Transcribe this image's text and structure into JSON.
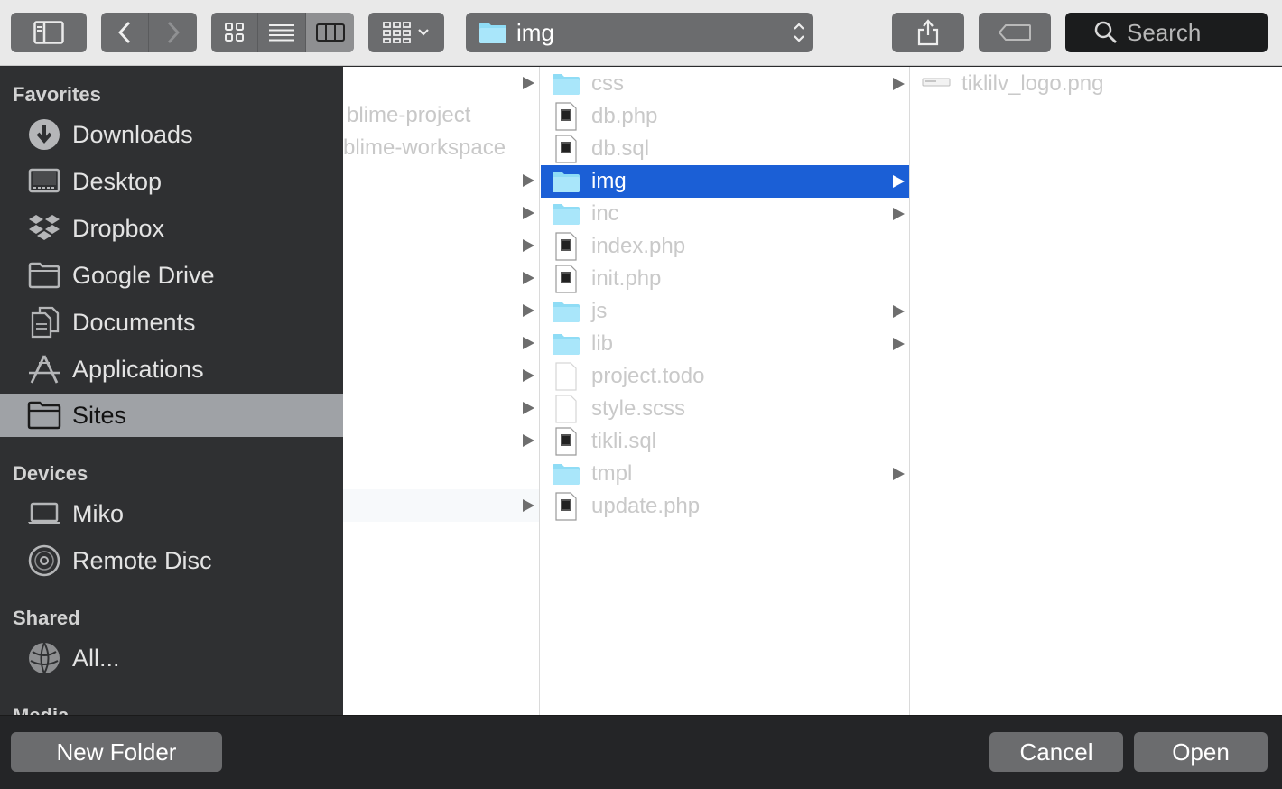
{
  "toolbar": {
    "path_label": "img",
    "search_placeholder": "Search"
  },
  "sidebar": {
    "favorites_heading": "Favorites",
    "favorites": [
      {
        "label": "Downloads",
        "icon": "download-icon"
      },
      {
        "label": "Desktop",
        "icon": "desktop-icon"
      },
      {
        "label": "Dropbox",
        "icon": "dropbox-icon"
      },
      {
        "label": "Google Drive",
        "icon": "folder-icon"
      },
      {
        "label": "Documents",
        "icon": "documents-icon"
      },
      {
        "label": "Applications",
        "icon": "applications-icon"
      },
      {
        "label": "Sites",
        "icon": "folder-icon",
        "selected": true
      }
    ],
    "devices_heading": "Devices",
    "devices": [
      {
        "label": "Miko",
        "icon": "laptop-icon"
      },
      {
        "label": "Remote Disc",
        "icon": "disc-icon"
      }
    ],
    "shared_heading": "Shared",
    "shared": [
      {
        "label": "All...",
        "icon": "network-icon"
      }
    ],
    "media_heading": "Media"
  },
  "column1": [
    {
      "label": "",
      "arrow": true
    },
    {
      "label": "blime-project",
      "arrow": false
    },
    {
      "label": "blime-workspace",
      "arrow": false
    },
    {
      "label": "",
      "arrow": true
    },
    {
      "label": "",
      "arrow": true
    },
    {
      "label": "",
      "arrow": true
    },
    {
      "label": "",
      "arrow": true
    },
    {
      "label": "",
      "arrow": true
    },
    {
      "label": "",
      "arrow": true
    },
    {
      "label": "",
      "arrow": true
    },
    {
      "label": "",
      "arrow": true
    },
    {
      "label": "",
      "arrow": true
    },
    {
      "label": "",
      "arrow": false
    },
    {
      "label": "",
      "arrow": true
    }
  ],
  "column2": [
    {
      "label": "css",
      "kind": "folder",
      "arrow": true
    },
    {
      "label": "db.php",
      "kind": "php",
      "arrow": false
    },
    {
      "label": "db.sql",
      "kind": "sql",
      "arrow": false
    },
    {
      "label": "img",
      "kind": "folder",
      "arrow": true,
      "selected": true
    },
    {
      "label": "inc",
      "kind": "folder",
      "arrow": true
    },
    {
      "label": "index.php",
      "kind": "php",
      "arrow": false
    },
    {
      "label": "init.php",
      "kind": "php",
      "arrow": false
    },
    {
      "label": "js",
      "kind": "folder",
      "arrow": true
    },
    {
      "label": "lib",
      "kind": "folder",
      "arrow": true
    },
    {
      "label": "project.todo",
      "kind": "blank",
      "arrow": false
    },
    {
      "label": "style.scss",
      "kind": "blank",
      "arrow": false
    },
    {
      "label": "tikli.sql",
      "kind": "sql",
      "arrow": false
    },
    {
      "label": "tmpl",
      "kind": "folder",
      "arrow": true
    },
    {
      "label": "update.php",
      "kind": "php",
      "arrow": false
    }
  ],
  "column3": [
    {
      "label": "tiklilv_logo.png",
      "kind": "image"
    }
  ],
  "footer": {
    "new_folder_label": "New Folder",
    "cancel_label": "Cancel",
    "open_label": "Open"
  },
  "colors": {
    "selection_blue": "#1b5fd6",
    "folder_blue": "#8fdcf5",
    "sidebar_bg": "#2f3032",
    "button_gray": "#6b6c6e"
  }
}
